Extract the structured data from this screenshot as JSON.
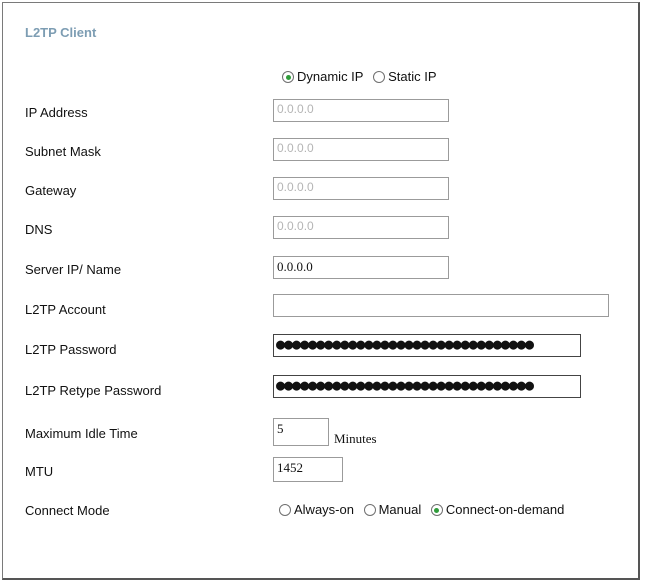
{
  "title": "L2TP Client",
  "ip_mode": {
    "options": [
      {
        "label": "Dynamic IP",
        "selected": true
      },
      {
        "label": "Static IP",
        "selected": false
      }
    ]
  },
  "fields": {
    "ip_address": {
      "label": "IP Address",
      "value": "0.0.0.0"
    },
    "subnet_mask": {
      "label": "Subnet Mask",
      "value": "0.0.0.0"
    },
    "gateway": {
      "label": "Gateway",
      "value": "0.0.0.0"
    },
    "dns": {
      "label": "DNS",
      "value": "0.0.0.0"
    },
    "server_ip": {
      "label": "Server IP/ Name",
      "value": "0.0.0.0"
    },
    "account": {
      "label": "L2TP Account",
      "value": ""
    },
    "password": {
      "label": "L2TP Password",
      "value": "●●●●●●●●●●●●●●●●●●●●●●●●●●●●●●●●"
    },
    "retype_password": {
      "label": "L2TP Retype Password",
      "value": "●●●●●●●●●●●●●●●●●●●●●●●●●●●●●●●●"
    },
    "idle_time": {
      "label": "Maximum Idle Time",
      "value": "5",
      "unit": "Minutes"
    },
    "mtu": {
      "label": "MTU",
      "value": "1452"
    }
  },
  "connect_mode": {
    "label": "Connect Mode",
    "options": [
      {
        "label": "Always-on",
        "selected": false
      },
      {
        "label": "Manual",
        "selected": false
      },
      {
        "label": "Connect-on-demand",
        "selected": true
      }
    ]
  },
  "colors": {
    "title": "#7d9db3",
    "radio_dot": "#2f9c3a",
    "border": "#9b9b9b"
  }
}
